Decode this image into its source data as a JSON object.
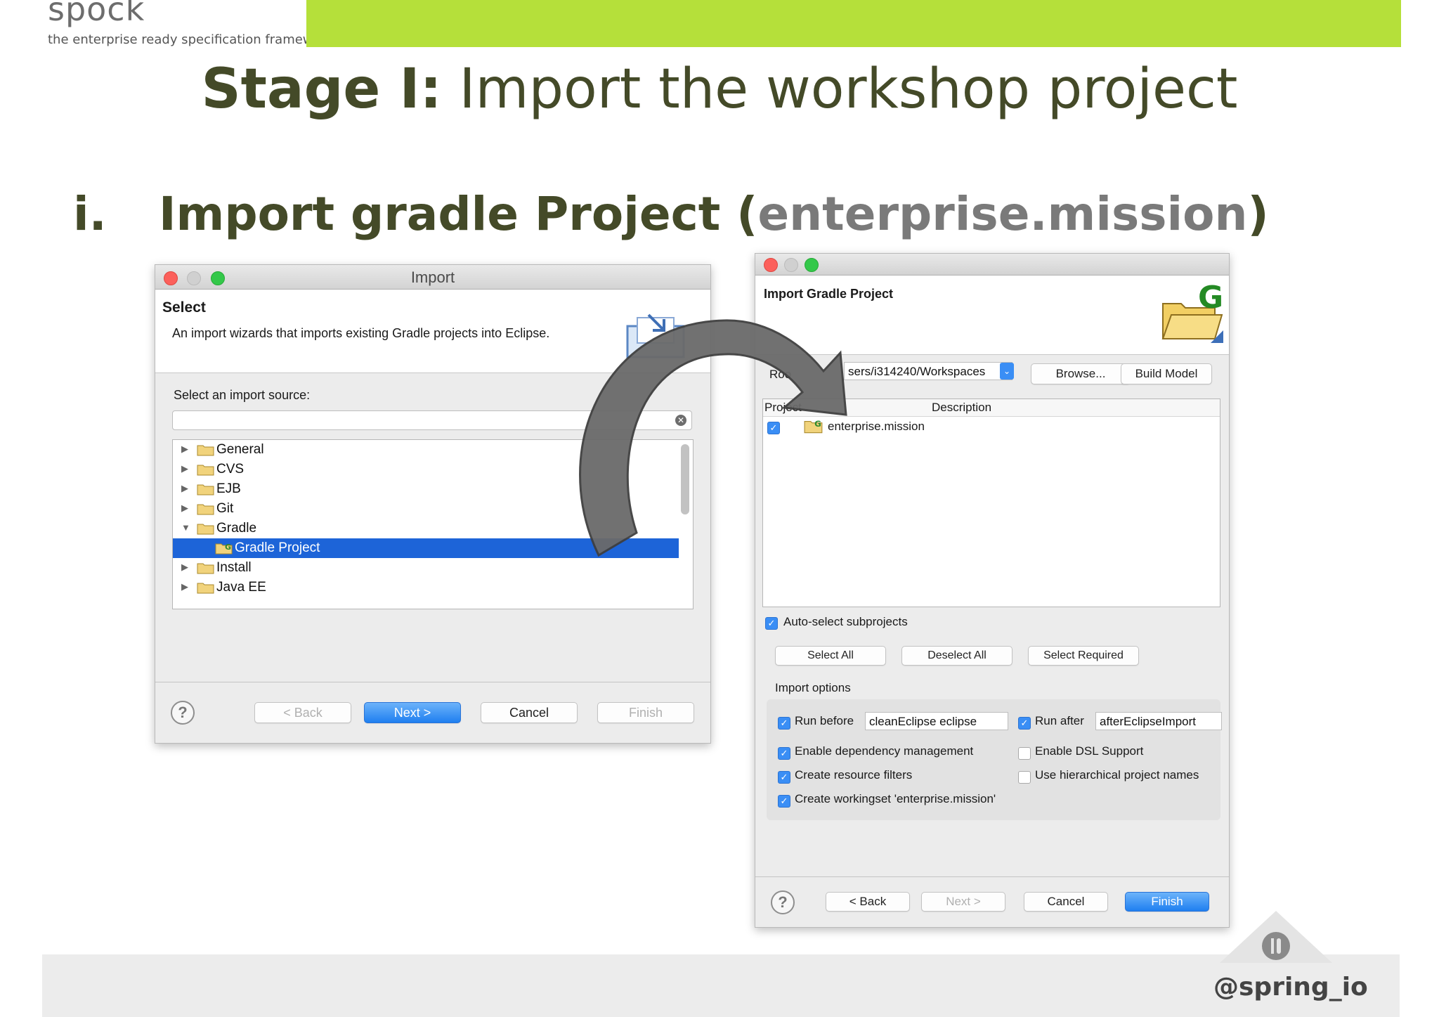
{
  "header": {
    "logo": "spock",
    "tagline": "the enterprise ready specification framework",
    "title_bold": "Stage I:",
    "title_rest": " Import the workshop project"
  },
  "bullet": {
    "number": "i.",
    "text": "Import gradle Project (",
    "accent": "enterprise.mission",
    "close": ")"
  },
  "import_dialog": {
    "window_title": "Import",
    "section_title": "Select",
    "description": "An import wizards that imports existing Gradle projects into Eclipse.",
    "source_label": "Select an import source:",
    "filter_value": "",
    "tree": [
      {
        "label": "General",
        "expanded": false
      },
      {
        "label": "CVS",
        "expanded": false
      },
      {
        "label": "EJB",
        "expanded": false
      },
      {
        "label": "Git",
        "expanded": false
      },
      {
        "label": "Gradle",
        "expanded": true
      },
      {
        "label": "Gradle Project",
        "child": true,
        "selected": true
      },
      {
        "label": "Install",
        "expanded": false
      },
      {
        "label": "Java EE",
        "expanded": false
      }
    ],
    "buttons": {
      "back": "< Back",
      "next": "Next >",
      "cancel": "Cancel",
      "finish": "Finish"
    },
    "help": "?"
  },
  "gradle_dialog": {
    "section_title": "Import Gradle Project",
    "root_label": "Roo",
    "root_value": "sers/i314240/Workspaces",
    "browse": "Browse...",
    "build_model": "Build Model",
    "col_project": "Project",
    "col_description": "Description",
    "project_name": "enterprise.mission",
    "auto_select": "Auto-select subprojects",
    "select_all": "Select All",
    "deselect_all": "Deselect All",
    "select_required": "Select Required",
    "import_options": "Import options",
    "run_before": "Run before",
    "run_before_value": "cleanEclipse eclipse",
    "run_after": "Run after",
    "run_after_value": "afterEclipseImport",
    "opt_dependency": "Enable dependency management",
    "opt_dsl": "Enable DSL Support",
    "opt_filters": "Create resource filters",
    "opt_hierarchical": "Use hierarchical project names",
    "opt_workingset": "Create workingset 'enterprise.mission'",
    "buttons": {
      "back": "< Back",
      "next": "Next >",
      "cancel": "Cancel",
      "finish": "Finish"
    },
    "help": "?"
  },
  "footer": {
    "handle": "@spring_io"
  },
  "colors": {
    "accent_green": "#b5e03a",
    "title_dark": "#444a28",
    "selection_blue": "#1d64d8"
  }
}
